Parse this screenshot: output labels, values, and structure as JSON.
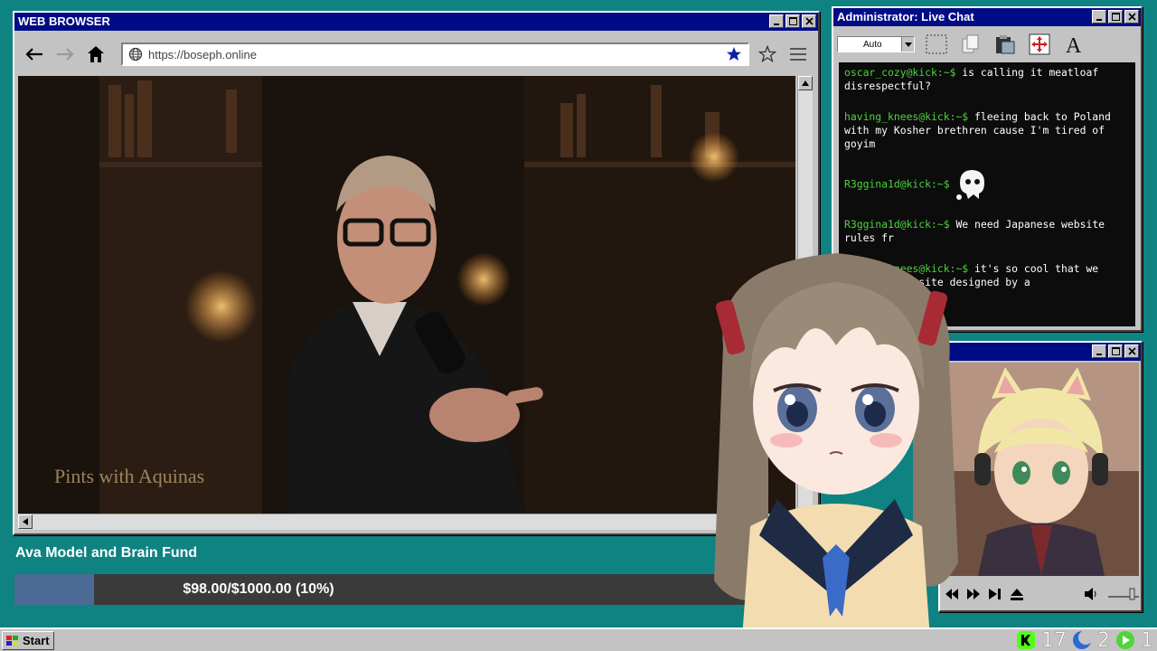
{
  "browser": {
    "title": "WEB BROWSER",
    "url": "https://boseph.online",
    "video_watermark": "Pints with Aquinas"
  },
  "chat": {
    "title": "Administrator: Live Chat",
    "zoom_select": "Auto",
    "messages": [
      {
        "user": "oscar_cozy@kick:~$",
        "text": " is calling it meatloaf disrespectful?"
      },
      {
        "user": "having_knees@kick:~$",
        "text": " fleeing back to Poland with my Kosher brethren cause I'm tired of goyim"
      },
      {
        "user": "R3ggina1d@kick:~$",
        "text": " ",
        "emote": "ghost-emote"
      },
      {
        "user": "R3ggina1d@kick:~$",
        "text": " We need Japanese website rules fr"
      },
      {
        "user": "having_knees@kick:~$",
        "text": " it's so cool that we browse a website designed by a"
      }
    ]
  },
  "fund": {
    "title": "Ava Model and Brain Fund",
    "label": "$98.00/$1000.00 (10%)",
    "progress_percent": 10
  },
  "taskbar": {
    "start_label": "Start",
    "kick_count": "17",
    "moon_count": "2",
    "play_count": "1"
  },
  "colors": {
    "desktop": "#0f8282",
    "titlebar": "#000c86",
    "chat_user": "#4bd43d",
    "progress_fill": "#4c6a96"
  }
}
